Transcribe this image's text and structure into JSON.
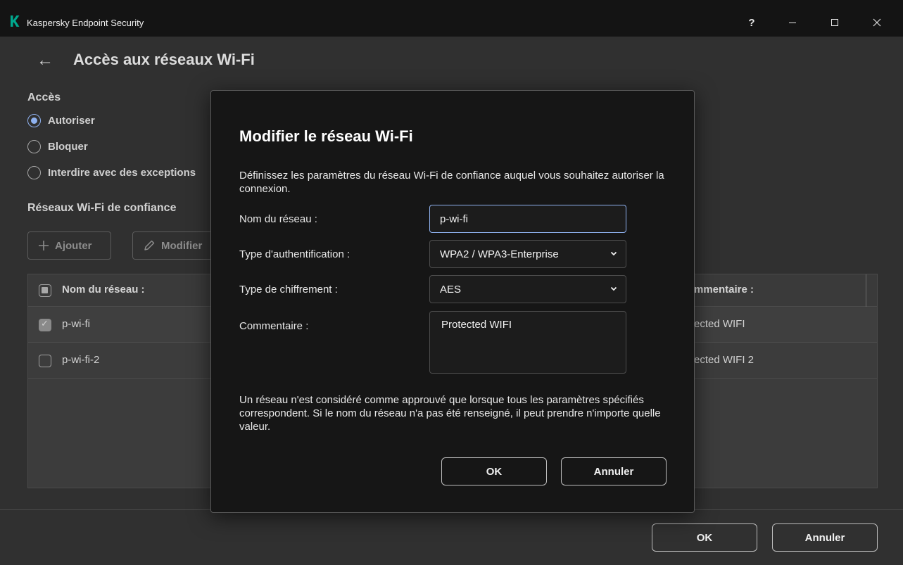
{
  "app": {
    "title": "Kaspersky Endpoint Security",
    "logo_letter": "K",
    "help_label": "?",
    "accent_color": "#8fb2f0",
    "brand_color": "#00a88e"
  },
  "page": {
    "back_icon": "←",
    "title": "Accès aux réseaux Wi-Fi",
    "access": {
      "label": "Accès",
      "options": [
        {
          "label": "Autoriser",
          "selected": true
        },
        {
          "label": "Bloquer",
          "selected": false
        },
        {
          "label": "Interdire avec des exceptions",
          "selected": false
        }
      ]
    },
    "trusted_label": "Réseaux Wi-Fi de confiance",
    "toolbar": {
      "add_label": "Ajouter",
      "edit_label": "Modifier"
    },
    "table": {
      "columns": {
        "name": "Nom du réseau :",
        "comment": "mmentaire :"
      },
      "rows": [
        {
          "name": "p-wi-fi",
          "comment": "ected WIFI",
          "checked": true
        },
        {
          "name": "p-wi-fi-2",
          "comment": "ected WIFI 2",
          "checked": false
        }
      ]
    },
    "footer": {
      "ok_label": "OK",
      "cancel_label": "Annuler"
    }
  },
  "dialog": {
    "title": "Modifier le réseau Wi-Fi",
    "description": "Définissez les paramètres du réseau Wi-Fi de confiance auquel vous souhaitez autoriser la connexion.",
    "network_name_label": "Nom du réseau :",
    "network_name_value": "p-wi-fi",
    "auth_type_label": "Type d'authentification :",
    "auth_type_value": "WPA2 / WPA3-Enterprise",
    "encryption_label": "Type de chiffrement :",
    "encryption_value": "AES",
    "comment_label": "Commentaire :",
    "comment_value": "Protected WIFI",
    "note": "Un réseau n'est considéré comme approuvé que lorsque tous les paramètres spécifiés correspondent. Si le nom du réseau n'a pas été renseigné, il peut prendre n'importe quelle valeur.",
    "ok_label": "OK",
    "cancel_label": "Annuler"
  }
}
